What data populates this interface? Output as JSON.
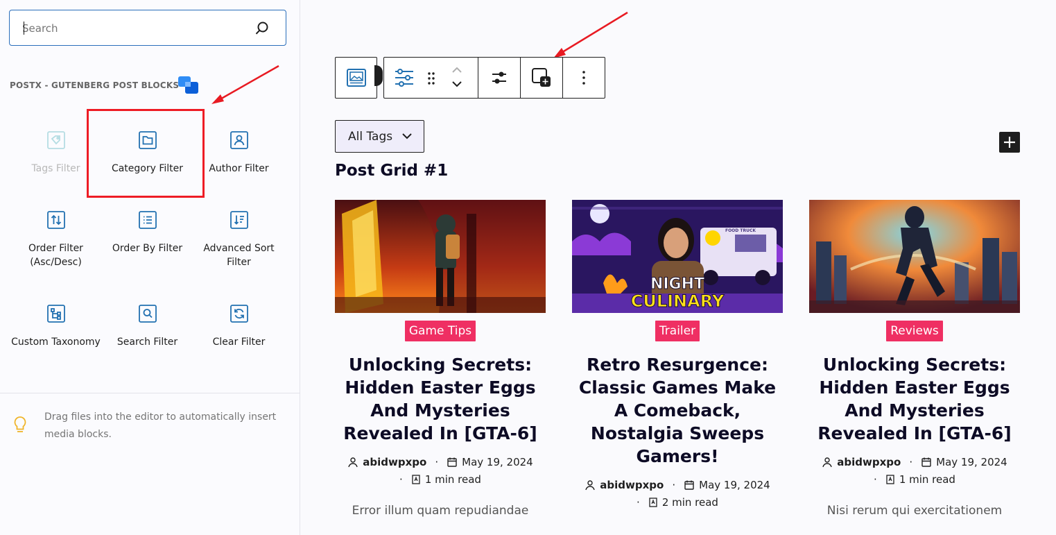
{
  "sidebar": {
    "search": {
      "placeholder": "Search"
    },
    "category_title": "POSTX - GUTENBERG POST BLOCKS",
    "blocks": [
      {
        "label": "Tags Filter",
        "icon": "tag-icon",
        "disabled": true
      },
      {
        "label": "Category Filter",
        "icon": "folder-icon",
        "highlighted": true
      },
      {
        "label": "Author Filter",
        "icon": "user-icon"
      },
      {
        "label": "Order Filter (Asc/Desc)",
        "icon": "sort-arrows-icon"
      },
      {
        "label": "Order By Filter",
        "icon": "list-icon"
      },
      {
        "label": "Advanced Sort Filter",
        "icon": "sort-desc-icon"
      },
      {
        "label": "Custom Taxonomy",
        "icon": "taxonomy-tree-icon"
      },
      {
        "label": "Search Filter",
        "icon": "search-icon"
      },
      {
        "label": "Clear Filter",
        "icon": "refresh-icon"
      }
    ],
    "tip": "Drag files into the editor to automatically insert media blocks."
  },
  "toolbar": {
    "buttons": [
      "image-block-icon",
      "settings-sliders-icon",
      "drag-handle-icon",
      "move-up-down-icon",
      "filter-options-icon",
      "add-block-icon",
      "more-options-icon"
    ]
  },
  "content": {
    "tags_select": "All Tags",
    "add_button": "+",
    "grid_title": "Post Grid #1",
    "posts": [
      {
        "category": "Game Tips",
        "title": "Unlocking Secrets: Hidden Easter Eggs And Mysteries Revealed In [GTA-6]",
        "author": "abidwpxpo",
        "date": "May 19, 2024",
        "read_time": "1 min read",
        "excerpt": "Error illum quam repudiandae"
      },
      {
        "category": "Trailer",
        "title": "Retro Resurgence: Classic Games Make A Comeback, Nostalgia Sweeps Gamers!",
        "author": "abidwpxpo",
        "date": "May 19, 2024",
        "read_time": "2 min read",
        "excerpt": "",
        "image_text_1": "NIGHT",
        "image_text_2": "CULINARY",
        "image_text_3": "FOOD TRUCK"
      },
      {
        "category": "Reviews",
        "title": "Unlocking Secrets: Hidden Easter Eggs And Mysteries Revealed In [GTA-6]",
        "author": "abidwpxpo",
        "date": "May 19, 2024",
        "read_time": "1 min read",
        "excerpt": "Nisi rerum qui exercitationem"
      }
    ]
  },
  "colors": {
    "accent": "#2a6ebb",
    "badge": "#ef2f63",
    "highlight": "#ee1c25",
    "icon_blue": "#2271b1"
  }
}
